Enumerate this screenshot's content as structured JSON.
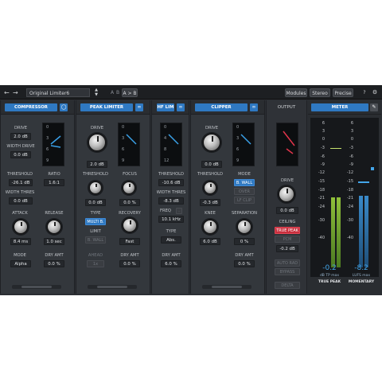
{
  "topbar": {
    "preset": "Original Limiter6",
    "ab_a": "A",
    "ab_b": "B",
    "ab_copy": "A > B",
    "modules": "Modules",
    "stereo": "Stereo",
    "precise": "Precise",
    "help": "?"
  },
  "compressor": {
    "title": "COMPRESSOR",
    "drive_label": "DRIVE",
    "drive": "2.0 dB",
    "width_drive_label": "WIDTH DRIVE",
    "width_drive": "0.0 dB",
    "scope_ticks": [
      "0",
      "3",
      "6",
      "9"
    ],
    "threshold_label": "THRESHOLD",
    "threshold": "-26.1 dB",
    "ratio_label": "RATIO",
    "ratio": "1.6:1",
    "width_thres_label": "WIDTH THRES",
    "width_thres": "0.0 dB",
    "attack_label": "ATTACK",
    "attack": "8.4 ms",
    "release_label": "RELEASE",
    "release": "1.0 sec",
    "mode_label": "MODE",
    "mode": "Alpha",
    "dry_label": "DRY AMT",
    "dry": "0.0 %"
  },
  "peak": {
    "title": "PEAK LIMITER",
    "drive_label": "DRIVE",
    "drive": "2.0 dB",
    "scope_ticks": [
      "0",
      "3",
      "6",
      "9"
    ],
    "threshold_label": "THRESHOLD",
    "threshold": "0.0 dB",
    "focus_label": "FOCUS",
    "focus": "0.0 %",
    "type_label": "TYPE",
    "type": "MULTI B.",
    "recovery_label": "RECOVERY",
    "recovery": "Fast",
    "limit_label": "LIMIT",
    "limit": "B. WALL",
    "ahead_label": "AHEAD",
    "ahead": "1x",
    "dry_label": "DRY AMT",
    "dry": "0.0 %"
  },
  "hf": {
    "title": "HF LIM",
    "scope_ticks": [
      "0",
      "4",
      "8",
      "12"
    ],
    "threshold_label": "THRESHOLD",
    "threshold": "-10.6 dB",
    "width_thres_label": "WIDTH THRES",
    "width_thres": "-8.3 dB",
    "freq_label": "FREQ",
    "freq": "10.1 kHz",
    "type_label": "TYPE",
    "type": "Abs.",
    "dry_label": "DRY AMT",
    "dry": "6.0 %"
  },
  "clipper": {
    "title": "CLIPPER",
    "drive_label": "DRIVE",
    "drive": "0.0 dB",
    "scope_ticks": [
      "0",
      "3",
      "6",
      "9"
    ],
    "threshold_label": "THRESHOLD",
    "threshold": "-0.3 dB",
    "mode_label": "MODE",
    "mode_opts": [
      "B. WALL",
      "OVER",
      "LF CLIP"
    ],
    "knee_label": "KNEE",
    "knee": "6.0 dB",
    "separation_label": "SEPARATION",
    "separation": "0 %",
    "dry_label": "DRY AMT",
    "dry": "0.0 %"
  },
  "output": {
    "title": "OUTPUT",
    "drive_label": "DRIVE",
    "drive": "0.0 dB",
    "ceiling_label": "CEILING",
    "ceiling_opts": [
      "TRUE PEAK",
      "PCM"
    ],
    "ceiling": "-0.2 dB",
    "btns": [
      "AUTO RAD",
      "BYPASS",
      "DELTA"
    ]
  },
  "meter": {
    "title": "METER",
    "scale": [
      "6",
      "3",
      "0",
      "-3",
      "-6",
      "-9",
      "-12",
      "-15",
      "-18",
      "-21",
      "-24",
      "-30",
      "-40"
    ],
    "tp_value": "-0.2",
    "tp_unit": "dB TP max",
    "tp_label": "TRUE PEAK",
    "lufs_value": "-8.2",
    "lufs_unit": "LUFS max",
    "lufs_label": "MOMENTARY",
    "levels": {
      "true_peak_db": -0.2,
      "momentary_lufs": -8.2
    }
  }
}
